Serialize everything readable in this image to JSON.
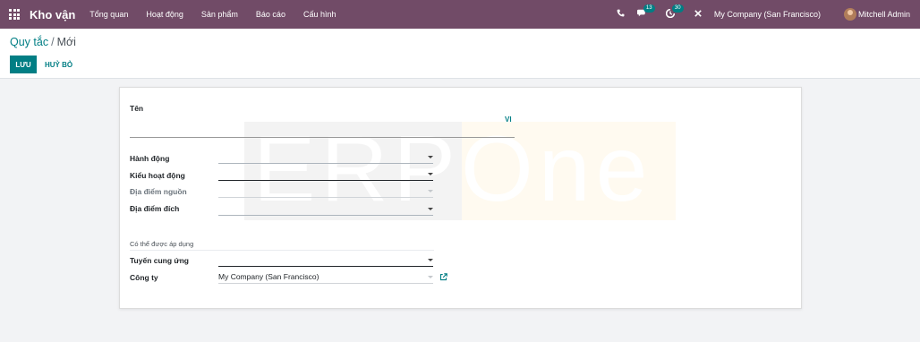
{
  "navbar": {
    "app_name": "Kho vận",
    "menu": [
      "Tổng quan",
      "Hoạt động",
      "Sản phẩm",
      "Báo cáo",
      "Cấu hình"
    ],
    "phone_icon": "phone-icon",
    "messages_count": "13",
    "activities_count": "30",
    "company": "My Company (San Francisco)",
    "user": "Mitchell Admin",
    "color": "#714b67"
  },
  "breadcrumb": {
    "parent": "Quy tắc",
    "separator": "/",
    "current": "Mới"
  },
  "actions": {
    "save": "LƯU",
    "discard": "HUỶ BỎ",
    "accent": "#017e84"
  },
  "form": {
    "name_label": "Tên",
    "lang": "VI",
    "fields": [
      {
        "label": "Hành động",
        "value": ""
      },
      {
        "label": "Kiểu hoạt động",
        "value": ""
      },
      {
        "label": "Địa điểm nguồn",
        "value": ""
      },
      {
        "label": "Địa điểm đích",
        "value": ""
      }
    ],
    "group_title": "Có thể được áp dụng",
    "route_label": "Tuyến cung ứng",
    "route_value": "",
    "company_label": "Công ty",
    "company_value": "My Company (San Francisco)"
  },
  "watermark": "ERPOne"
}
